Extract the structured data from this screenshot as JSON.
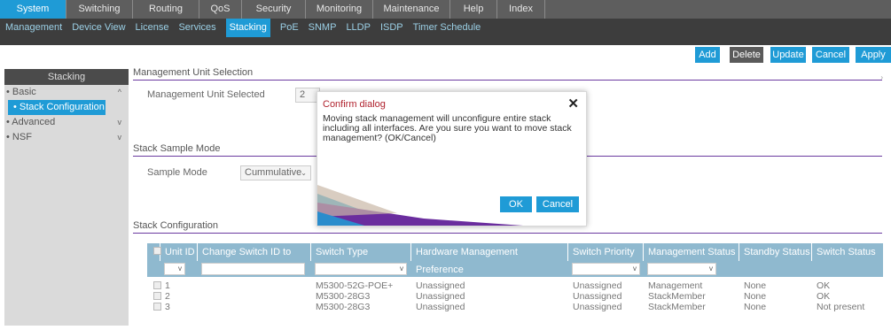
{
  "top_nav": {
    "tabs": [
      "System",
      "Switching",
      "Routing",
      "QoS",
      "Security",
      "Monitoring",
      "Maintenance",
      "Help",
      "Index"
    ],
    "active": "System"
  },
  "sub_nav": {
    "items": [
      "Management",
      "Device View",
      "License",
      "Services",
      "Stacking",
      "PoE",
      "SNMP",
      "LLDP",
      "ISDP",
      "Timer Schedule"
    ],
    "active": "Stacking"
  },
  "actions": {
    "add": "Add",
    "delete": "Delete",
    "update": "Update",
    "cancel": "Cancel",
    "apply": "Apply"
  },
  "sidebar": {
    "title": "Stacking",
    "items": [
      {
        "label": "• Basic",
        "chevron": "^"
      },
      {
        "label": "• Stack Configuration",
        "chevron": ""
      },
      {
        "label": "• Advanced",
        "chevron": "v"
      },
      {
        "label": "• NSF",
        "chevron": "v"
      }
    ]
  },
  "management_unit": {
    "section_title": "Management Unit Selection",
    "label": "Management Unit Selected",
    "value": "2"
  },
  "sample_mode": {
    "section_title": "Stack Sample Mode",
    "label": "Sample Mode",
    "value": "Cummulative"
  },
  "stack_config": {
    "section_title": "Stack Configuration",
    "columns": [
      "",
      "Unit ID",
      "Change Switch ID to",
      "Switch Type",
      "Hardware Management Preference",
      "Switch Priority",
      "Management Status",
      "Standby Status",
      "Switch Status"
    ],
    "rows": [
      {
        "unit": "1",
        "type": "M5300-52G-POE+",
        "hw_pref": "Unassigned",
        "priority": "Unassigned",
        "mgmt": "Management",
        "standby": "None",
        "status": "OK"
      },
      {
        "unit": "2",
        "type": "M5300-28G3",
        "hw_pref": "Unassigned",
        "priority": "Unassigned",
        "mgmt": "StackMember",
        "standby": "None",
        "status": "OK"
      },
      {
        "unit": "3",
        "type": "M5300-28G3",
        "hw_pref": "Unassigned",
        "priority": "Unassigned",
        "mgmt": "StackMember",
        "standby": "None",
        "status": "Not present"
      }
    ]
  },
  "dialog": {
    "title": "Confirm dialog",
    "message": "Moving stack management will unconfigure entire stack including all interfaces. Are you sure you want to move stack management? (OK/Cancel)",
    "ok": "OK",
    "cancel": "Cancel"
  },
  "colors": {
    "accent": "#1f9bd6",
    "section_line": "#6b3aa0",
    "dialog_title": "#b0222e"
  }
}
